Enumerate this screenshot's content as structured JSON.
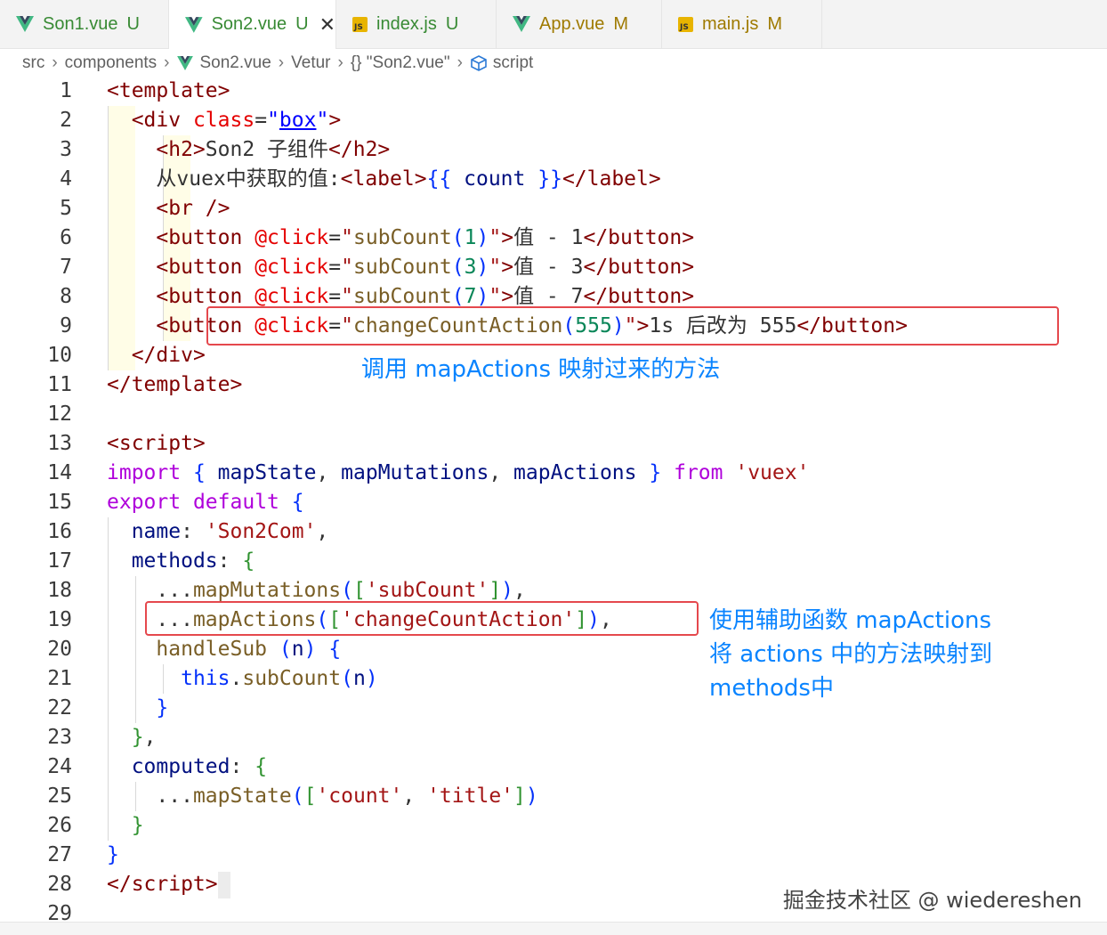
{
  "tabs": [
    {
      "name": "Son1.vue",
      "status": "U",
      "type": "vue",
      "active": false
    },
    {
      "name": "Son2.vue",
      "status": "U",
      "type": "vue",
      "active": true
    },
    {
      "name": "index.js",
      "status": "U",
      "type": "js",
      "active": false
    },
    {
      "name": "App.vue",
      "status": "M",
      "type": "vue",
      "active": false
    },
    {
      "name": "main.js",
      "status": "M",
      "type": "js",
      "active": false
    }
  ],
  "breadcrumb": [
    "src",
    "components",
    "Son2.vue",
    "Vetur",
    "{} \"Son2.vue\"",
    "script"
  ],
  "line_numbers": [
    "1",
    "2",
    "3",
    "4",
    "5",
    "6",
    "7",
    "8",
    "9",
    "10",
    "11",
    "12",
    "13",
    "14",
    "15",
    "16",
    "17",
    "18",
    "19",
    "20",
    "21",
    "22",
    "23",
    "24",
    "25",
    "26",
    "27",
    "28",
    "29"
  ],
  "annotations": {
    "template_note": "调用 mapActions 映射过来的方法",
    "script_note_1": "使用辅助函数 mapActions",
    "script_note_2": "将 actions 中的方法映射到",
    "script_note_3": "methods中"
  },
  "watermark": "掘金技术社区 @ wiedereshen",
  "colors": {
    "vue": "#41b883",
    "vue_dark": "#35495e",
    "annotation": "#0a84ff",
    "highlight_box": "#e5484d",
    "status_u": "#388a34",
    "status_m": "#9f7a00"
  }
}
